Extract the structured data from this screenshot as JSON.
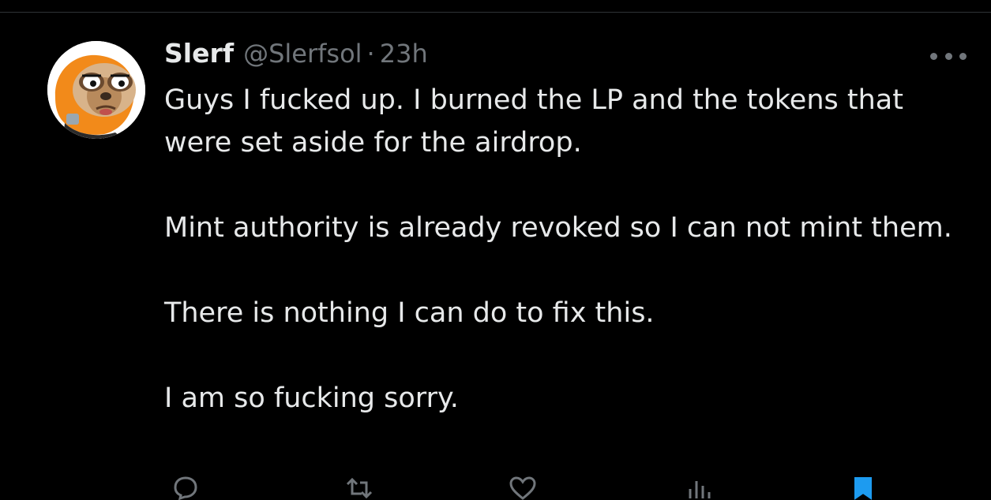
{
  "tweet": {
    "author": {
      "display_name": "Slerf",
      "handle": "@Slerfsol",
      "avatar_icon": "sloth-avatar-icon"
    },
    "separator": "·",
    "timestamp": "23h",
    "more_icon": "more-dots-icon",
    "paragraphs": [
      "Guys I fucked up. I burned the LP and the tokens that were set aside for the airdrop.",
      "Mint authority is already revoked so I can not mint them.",
      "There is nothing I can do to fix this.",
      "I am so fucking sorry."
    ]
  },
  "colors": {
    "background": "#000000",
    "text_primary": "#e7e9ea",
    "text_secondary": "#71767b",
    "divider": "#2f3336",
    "accent": "#1d9bf0"
  },
  "action_bar": {
    "icons": [
      "reply-icon",
      "retweet-icon",
      "like-icon",
      "views-icon",
      "bookmark-icon"
    ]
  }
}
